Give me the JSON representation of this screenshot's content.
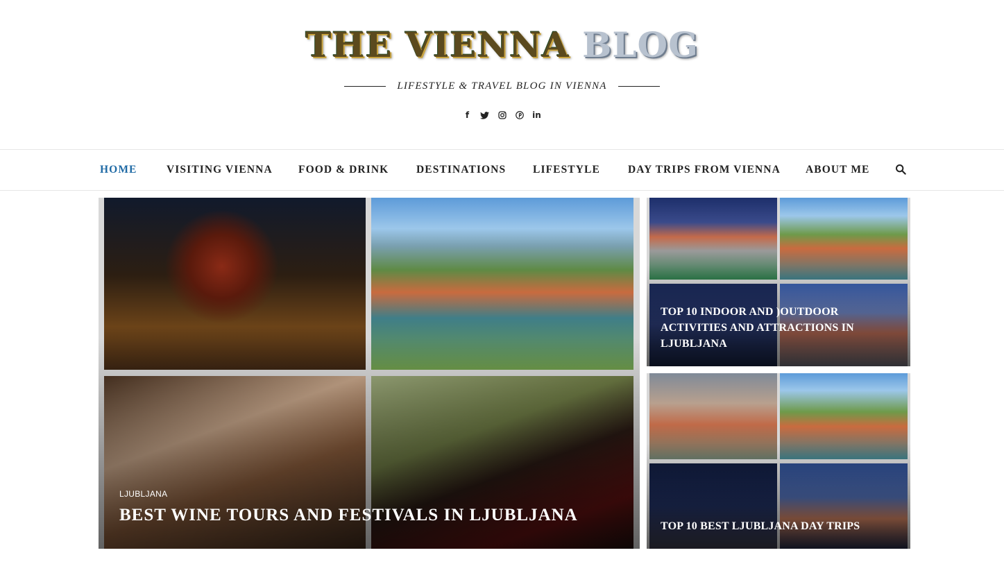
{
  "header": {
    "logo_part1": "THE VIENNA",
    "logo_part2": "BLOG",
    "tagline": "LIFESTYLE & TRAVEL BLOG IN VIENNA",
    "social": [
      {
        "name": "facebook-icon",
        "glyph": "f"
      },
      {
        "name": "twitter-icon",
        "glyph": "🐦"
      },
      {
        "name": "instagram-icon",
        "glyph": "◎"
      },
      {
        "name": "pinterest-icon",
        "glyph": "℗"
      },
      {
        "name": "linkedin-icon",
        "glyph": "in"
      }
    ]
  },
  "nav": {
    "items": [
      {
        "label": "HOME",
        "active": true
      },
      {
        "label": "VISITING VIENNA",
        "active": false
      },
      {
        "label": "FOOD & DRINK",
        "active": false
      },
      {
        "label": "DESTINATIONS",
        "active": false
      },
      {
        "label": "LIFESTYLE",
        "active": false
      },
      {
        "label": "DAY TRIPS FROM VIENNA",
        "active": false
      },
      {
        "label": "ABOUT ME",
        "active": false
      }
    ],
    "search_icon": "search-icon",
    "active_color": "#1f6aa5"
  },
  "featured": {
    "main": {
      "category": "LJUBLJANA",
      "title": "BEST WINE TOURS AND FESTIVALS IN LJUBLJANA"
    },
    "side": [
      {
        "title": "TOP 10 INDOOR AND )OUTDOOR ACTIVITIES AND ATTRACTIONS IN LJUBLJANA"
      },
      {
        "title": "TOP 10 BEST LJUBLJANA DAY TRIPS"
      }
    ]
  }
}
